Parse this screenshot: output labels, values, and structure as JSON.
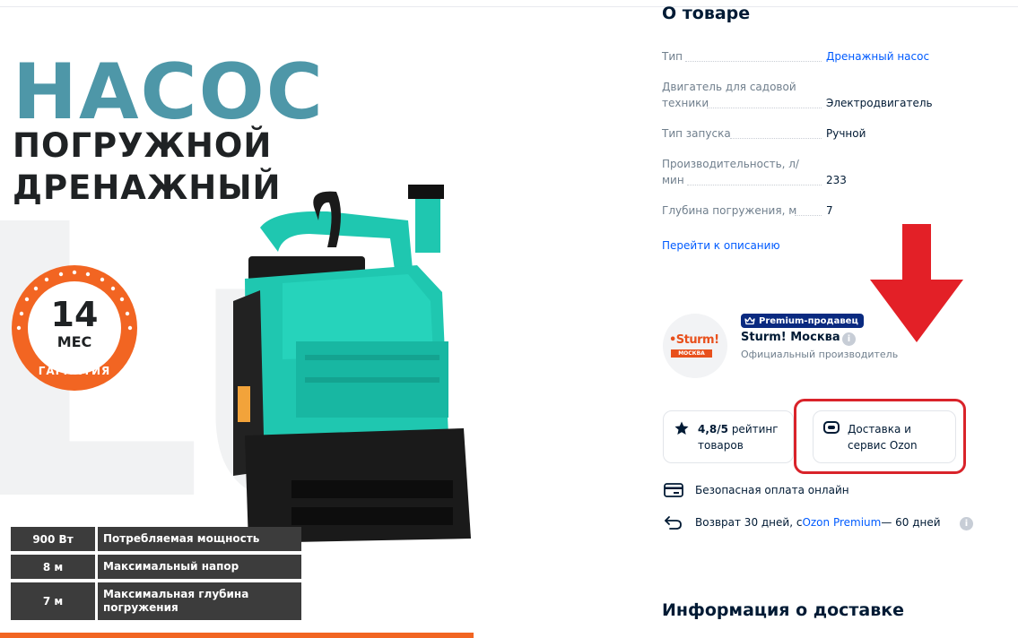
{
  "product_image": {
    "promo_title": "НАСОС",
    "promo_line1": "ПОГРУЖНОЙ",
    "promo_line2": "ДРЕНАЖНЫЙ",
    "warranty_number": "14",
    "warranty_unit": "МЕС",
    "warranty_label": "ГАРАНТИЯ",
    "pump_brand": "Sturm!",
    "specs": [
      {
        "value": "900 Вт",
        "name": "Потребляемая мощность"
      },
      {
        "value": "8 м",
        "name": "Максимальный напор"
      },
      {
        "value": "7 м",
        "name": "Максимальная глубина погружения"
      }
    ],
    "colors": {
      "title": "#4e97a8",
      "accent": "#f26522",
      "pump_body": "#1fc7b0"
    }
  },
  "about": {
    "title": "О товаре",
    "attributes": [
      {
        "key": "Тип",
        "value": "Дренажный насос",
        "is_link": true
      },
      {
        "key": "Двигатель для садовой техники",
        "value": "Электродвигатель",
        "is_link": false
      },
      {
        "key": "Тип запуска",
        "value": "Ручной",
        "is_link": false
      },
      {
        "key": "Производительность, л/мин",
        "value": "233",
        "is_link": false
      },
      {
        "key": "Глубина погружения, м",
        "value": "7",
        "is_link": false
      }
    ],
    "description_link": "Перейти к описанию"
  },
  "seller": {
    "logo_brand": "•Sturm!",
    "logo_city": "МОСКВА",
    "premium_badge": "Premium-продавец",
    "name": "Sturm! Москва",
    "subtitle": "Официальный производитель",
    "info_icon": "i"
  },
  "cards": {
    "rating_value": "4,8/5",
    "rating_text": " рейтинг товаров",
    "delivery_text": "Доставка и сервис Ozon"
  },
  "features": {
    "payment": "Безопасная оплата онлайн",
    "return_prefix": "Возврат 30 дней, с ",
    "return_link": "Ozon Premium",
    "return_suffix": " — 60 дней"
  },
  "delivery_section_title": "Информация о доставке",
  "annotation": {
    "arrow_color": "#e32027",
    "box_color": "#d9232a"
  }
}
